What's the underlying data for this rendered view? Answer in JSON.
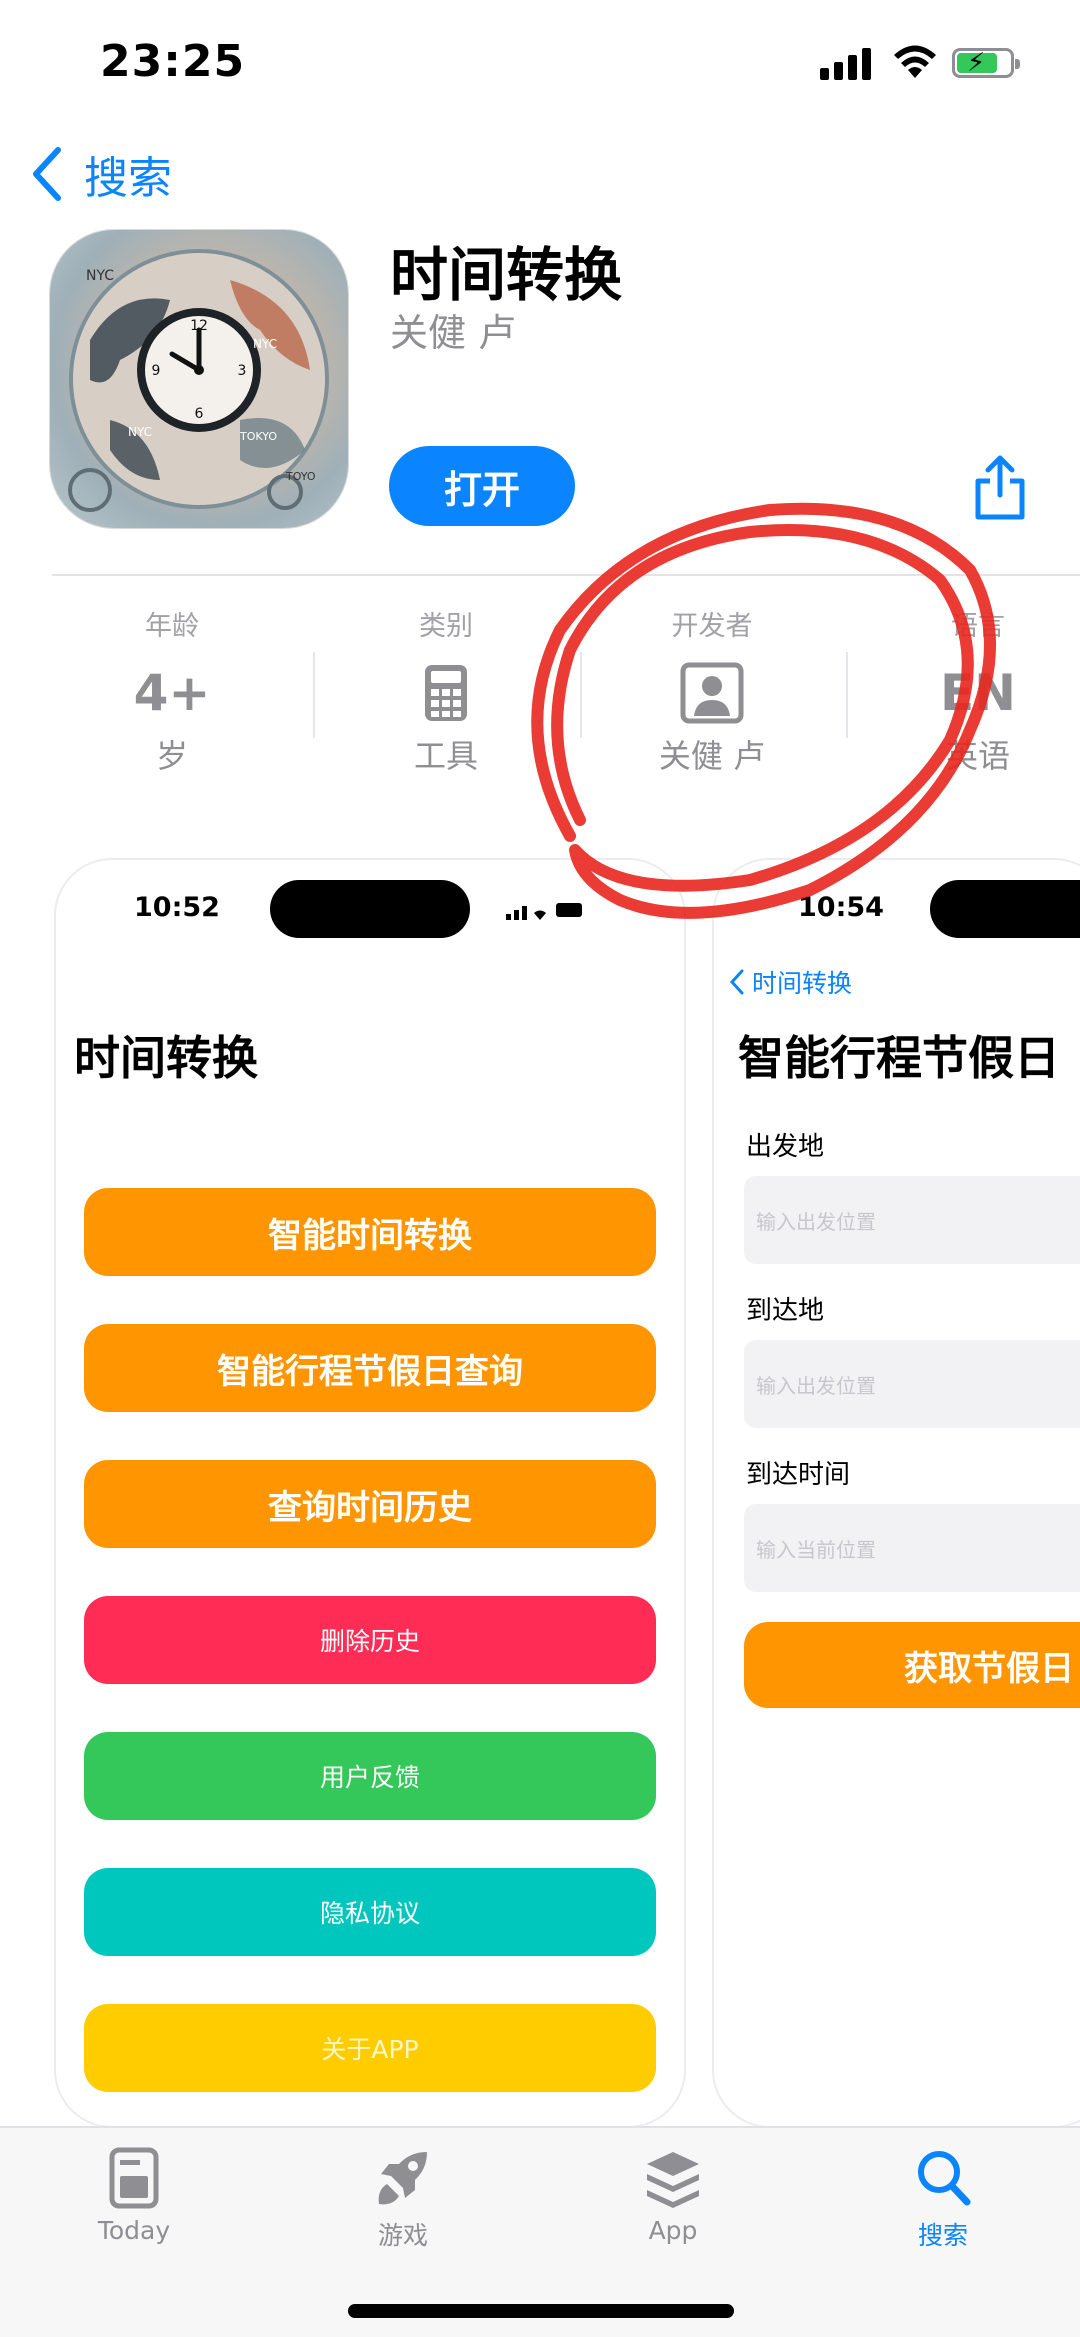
{
  "status_bar": {
    "time": "23:25"
  },
  "nav": {
    "back_label": "搜索"
  },
  "app": {
    "title": "时间转换",
    "developer": "关健 卢",
    "open_label": "打开",
    "icon_labels": [
      "NYC",
      "NYC",
      "TOKYO",
      "NYC",
      "TOYO"
    ]
  },
  "info": {
    "age": {
      "label": "年龄",
      "value": "4+",
      "sub": "岁"
    },
    "category": {
      "label": "类别",
      "sub": "工具",
      "icon": "calculator-icon"
    },
    "developer": {
      "label": "开发者",
      "sub": "关健 卢",
      "icon": "person-square-icon"
    },
    "language": {
      "label": "语言",
      "value": "EN",
      "sub": "英语"
    }
  },
  "screenshot1": {
    "time": "10:52",
    "title": "时间转换",
    "buttons": [
      {
        "label": "智能时间转换",
        "color": "#ff9500"
      },
      {
        "label": "智能行程节假日查询",
        "color": "#ff9500"
      },
      {
        "label": "查询时间历史",
        "color": "#ff9500"
      },
      {
        "label": "删除历史",
        "color": "#ff2d55"
      },
      {
        "label": "用户反馈",
        "color": "#34c759"
      },
      {
        "label": "隐私协议",
        "color": "#00c7be"
      },
      {
        "label": "关于APP",
        "color": "#ffcc00"
      }
    ]
  },
  "screenshot2": {
    "time": "10:54",
    "back_label": "时间转换",
    "title": "智能行程节假日",
    "fields": [
      {
        "label": "出发地",
        "placeholder": "输入出发位置"
      },
      {
        "label": "到达地",
        "placeholder": "输入出发位置"
      },
      {
        "label": "到达时间",
        "placeholder": "输入当前位置"
      }
    ],
    "button_label": "获取节假日"
  },
  "tabbar": {
    "tabs": [
      {
        "label": "Today",
        "icon": "today-icon"
      },
      {
        "label": "游戏",
        "icon": "rocket-icon"
      },
      {
        "label": "App",
        "icon": "apps-stack-icon"
      },
      {
        "label": "搜索",
        "icon": "search-icon",
        "active": true
      }
    ]
  },
  "colors": {
    "accent": "#0a84ff",
    "annotation": "#e8261e"
  }
}
